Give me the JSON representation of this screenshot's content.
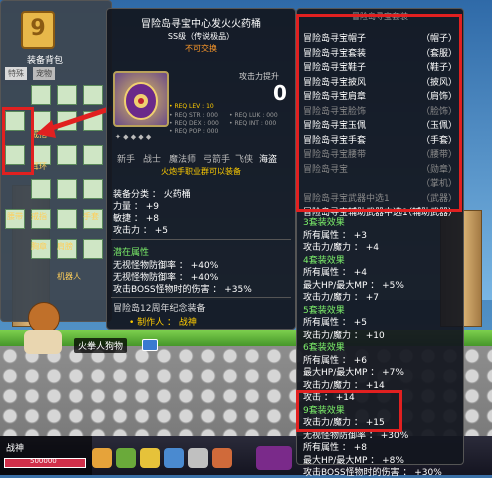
{
  "inventory": {
    "title": "装备背包",
    "level_badge": "9",
    "tab_main": "特殊",
    "tab_second": "宠物",
    "slot_labels": [
      "戒指",
      "耳环",
      "腰带",
      "胸章",
      "肩膀",
      "戒指",
      "手套",
      "机器人"
    ]
  },
  "item": {
    "name": "冒险岛寻宝中心发火火药桶",
    "grade": "SS级（传说极品）",
    "trade": "不可交换",
    "attack_increase_label": "攻击力提升",
    "attack_increase_value": "0",
    "req_lines": [
      "• REQ LEV : 10",
      "• REQ STR : 000",
      "• REQ LUK : 000",
      "• REQ DEX : 000",
      "• REQ INT : 000",
      "• REQ POP : 000"
    ],
    "jobs": [
      "新手",
      "战士",
      "魔法师",
      "弓箭手",
      "飞侠",
      "海盗"
    ],
    "job_notice": "火炮手职业群可以装备",
    "category": "装备分类 ：  火药桶",
    "stats": [
      "力量 ：  +9",
      "敏捷 ：  +8",
      "攻击力 ：  +5"
    ],
    "potential_title": "潜在属性",
    "potential_lines": [
      "无视怪物防御率 ：  +40%",
      "无视怪物防御率 ：  +40%",
      "攻击BOSS怪物时的伤害 ：  +35%"
    ],
    "anniversary": "冒险岛12周年纪念装备",
    "creator": "• 制作人 ：  战神"
  },
  "set_info": {
    "header": "冒险岛寻宝套装",
    "items": [
      {
        "name": "冒险岛寻宝帽子",
        "type": "（帽子）",
        "owned": true
      },
      {
        "name": "冒险岛寻宝套装",
        "type": "（套服）",
        "owned": true
      },
      {
        "name": "冒险岛寻宝鞋子",
        "type": "（鞋子）",
        "owned": true
      },
      {
        "name": "冒险岛寻宝披风",
        "type": "（披风）",
        "owned": true
      },
      {
        "name": "冒险岛寻宝肩章",
        "type": "（肩饰）",
        "owned": true
      },
      {
        "name": "冒险岛寻宝脸饰",
        "type": "（脸饰）",
        "owned": false
      },
      {
        "name": "冒险岛寻宝玉佩",
        "type": "（玉佩）",
        "owned": true
      },
      {
        "name": "冒险岛寻宝手套",
        "type": "（手套）",
        "owned": true
      },
      {
        "name": "冒险岛寻宝腰带",
        "type": "（腰带）",
        "owned": false
      },
      {
        "name": "冒险岛寻宝",
        "type": "（勋章）",
        "owned": false
      },
      {
        "name": "",
        "type": "（掌机）",
        "owned": false
      },
      {
        "name": "冒险岛寻宝武器中选1",
        "type": "（武器）",
        "owned": false
      },
      {
        "name": "冒险岛寻宝辅助武器中选1",
        "type": "（辅助武器）",
        "owned": true
      }
    ],
    "effects": [
      {
        "title": "3套装效果",
        "lines": [
          "所有属性 ：  +3",
          "攻击力/魔力 ：  +4"
        ]
      },
      {
        "title": "4套装效果",
        "lines": [
          "所有属性 ：  +4",
          "最大HP/最大MP ：  +5%",
          "攻击力/魔力 ：  +7"
        ]
      },
      {
        "title": "5套装效果",
        "lines": [
          "所有属性 ：  +5",
          "攻击力/魔力 ：  +10"
        ]
      },
      {
        "title": "6套装效果",
        "lines": [
          "所有属性 ：  +6",
          "最大HP/最大MP ：  +7%",
          "攻击力/魔力 ：  +14",
          "攻击 ：  +14"
        ]
      },
      {
        "title": "9套装效果",
        "lines": [
          "攻击力/魔力 ：  +15",
          "无视怪物防御率 ：  +30%"
        ]
      },
      {
        "title": "",
        "lines": [
          "所有属性 ：  +8",
          "最大HP/最大MP ：  +8%",
          "攻击BOSS怪物时的伤害 ：  +30%"
        ]
      }
    ]
  },
  "world": {
    "npc_name": "火拳人狗物",
    "hud_name": "战神",
    "hp_text": "500000"
  },
  "colors": {
    "highlight_red": "#e12020",
    "set_green": "#7cf06a",
    "gold": "#ffcc00"
  }
}
